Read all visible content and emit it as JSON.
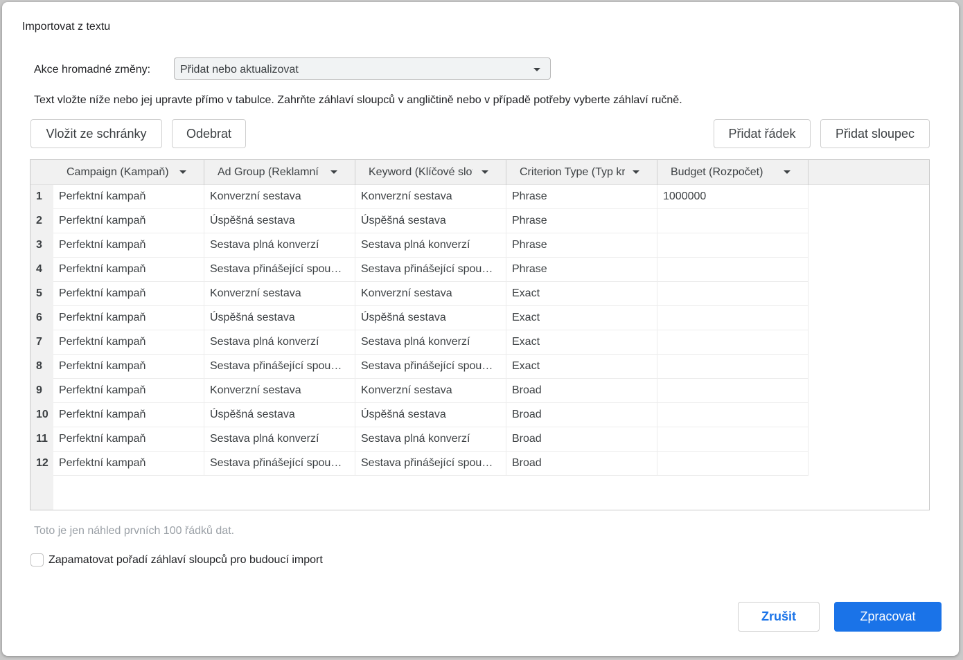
{
  "dialog": {
    "title": "Importovat z textu",
    "action_label": "Akce hromadné změny:",
    "action_value": "Přidat nebo aktualizovat",
    "hint": "Text vložte níže nebo jej upravte přímo v tabulce. Zahrňte záhlaví sloupců v angličtině nebo v případě potřeby vyberte záhlaví ručně.",
    "paste_label": "Vložit ze schránky",
    "remove_label": "Odebrat",
    "add_row_label": "Přidat řádek",
    "add_column_label": "Přidat sloupec",
    "preview_note": "Toto je jen náhled prvních 100 řádků dat.",
    "remember_label": "Zapamatovat pořadí záhlaví sloupců pro budoucí import",
    "cancel_label": "Zrušit",
    "process_label": "Zpracovat"
  },
  "table": {
    "headers": [
      "Campaign (Kampaň)",
      "Ad Group (Reklamní sestava)",
      "Keyword (Klíčové slovo)",
      "Criterion Type (Typ kritéria)",
      "Budget (Rozpočet)"
    ],
    "rows": [
      {
        "num": "1",
        "cells": [
          "Perfektní kampaň",
          "Konverzní sestava",
          "Konverzní sestava",
          "Phrase",
          "1000000"
        ]
      },
      {
        "num": "2",
        "cells": [
          "Perfektní kampaň",
          "Úspěšná sestava",
          "Úspěšná sestava",
          "Phrase",
          ""
        ]
      },
      {
        "num": "3",
        "cells": [
          "Perfektní kampaň",
          "Sestava plná konverzí",
          "Sestava plná konverzí",
          "Phrase",
          ""
        ]
      },
      {
        "num": "4",
        "cells": [
          "Perfektní kampaň",
          "Sestava přinášející spou…",
          "Sestava přinášející spou…",
          "Phrase",
          ""
        ]
      },
      {
        "num": "5",
        "cells": [
          "Perfektní kampaň",
          "Konverzní sestava",
          "Konverzní sestava",
          "Exact",
          ""
        ]
      },
      {
        "num": "6",
        "cells": [
          "Perfektní kampaň",
          "Úspěšná sestava",
          "Úspěšná sestava",
          "Exact",
          ""
        ]
      },
      {
        "num": "7",
        "cells": [
          "Perfektní kampaň",
          "Sestava plná konverzí",
          "Sestava plná konverzí",
          "Exact",
          ""
        ]
      },
      {
        "num": "8",
        "cells": [
          "Perfektní kampaň",
          "Sestava přinášející spou…",
          "Sestava přinášející spou…",
          "Exact",
          ""
        ]
      },
      {
        "num": "9",
        "cells": [
          "Perfektní kampaň",
          "Konverzní sestava",
          "Konverzní sestava",
          "Broad",
          ""
        ]
      },
      {
        "num": "10",
        "cells": [
          "Perfektní kampaň",
          "Úspěšná sestava",
          "Úspěšná sestava",
          "Broad",
          ""
        ]
      },
      {
        "num": "11",
        "cells": [
          "Perfektní kampaň",
          "Sestava plná konverzí",
          "Sestava plná konverzí",
          "Broad",
          ""
        ]
      },
      {
        "num": "12",
        "cells": [
          "Perfektní kampaň",
          "Sestava přinášející spou…",
          "Sestava přinášející spou…",
          "Broad",
          ""
        ]
      }
    ]
  },
  "colors": {
    "accent": "#1a73e8",
    "header_bg": "#f1f1f1",
    "note_text": "#9aa0a6"
  }
}
